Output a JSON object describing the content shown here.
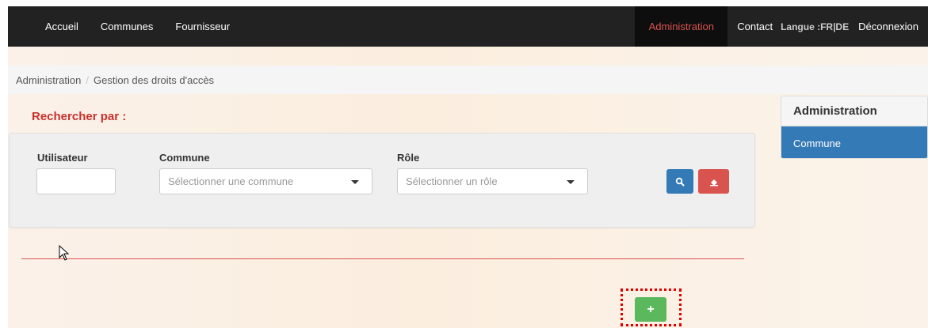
{
  "navbar": {
    "items": [
      "Accueil",
      "Communes",
      "Fournisseur"
    ],
    "admin_label": "Administration",
    "contact_label": "Contact",
    "lang_label": "Langue :",
    "lang_options": "FR|DE",
    "logout_label": "Déconnexion"
  },
  "breadcrumb": {
    "root": "Administration",
    "separator": "/",
    "current": "Gestion des droits d'accès"
  },
  "search": {
    "title": "Rechercher par :",
    "user_label": "Utilisateur",
    "user_value": "",
    "commune_label": "Commune",
    "commune_placeholder": "Sélectionner une commune",
    "role_label": "Rôle",
    "role_placeholder": "Sélectionner un rôle",
    "search_icon": "search-icon",
    "clear_icon": "eraser-icon"
  },
  "actions": {
    "add_label": "+"
  },
  "side_panel": {
    "title": "Administration",
    "items": [
      "Commune"
    ]
  },
  "colors": {
    "navbar_bg": "#222222",
    "accent_red": "#d9534f",
    "primary_blue": "#337ab7",
    "success_green": "#5cb85c"
  }
}
